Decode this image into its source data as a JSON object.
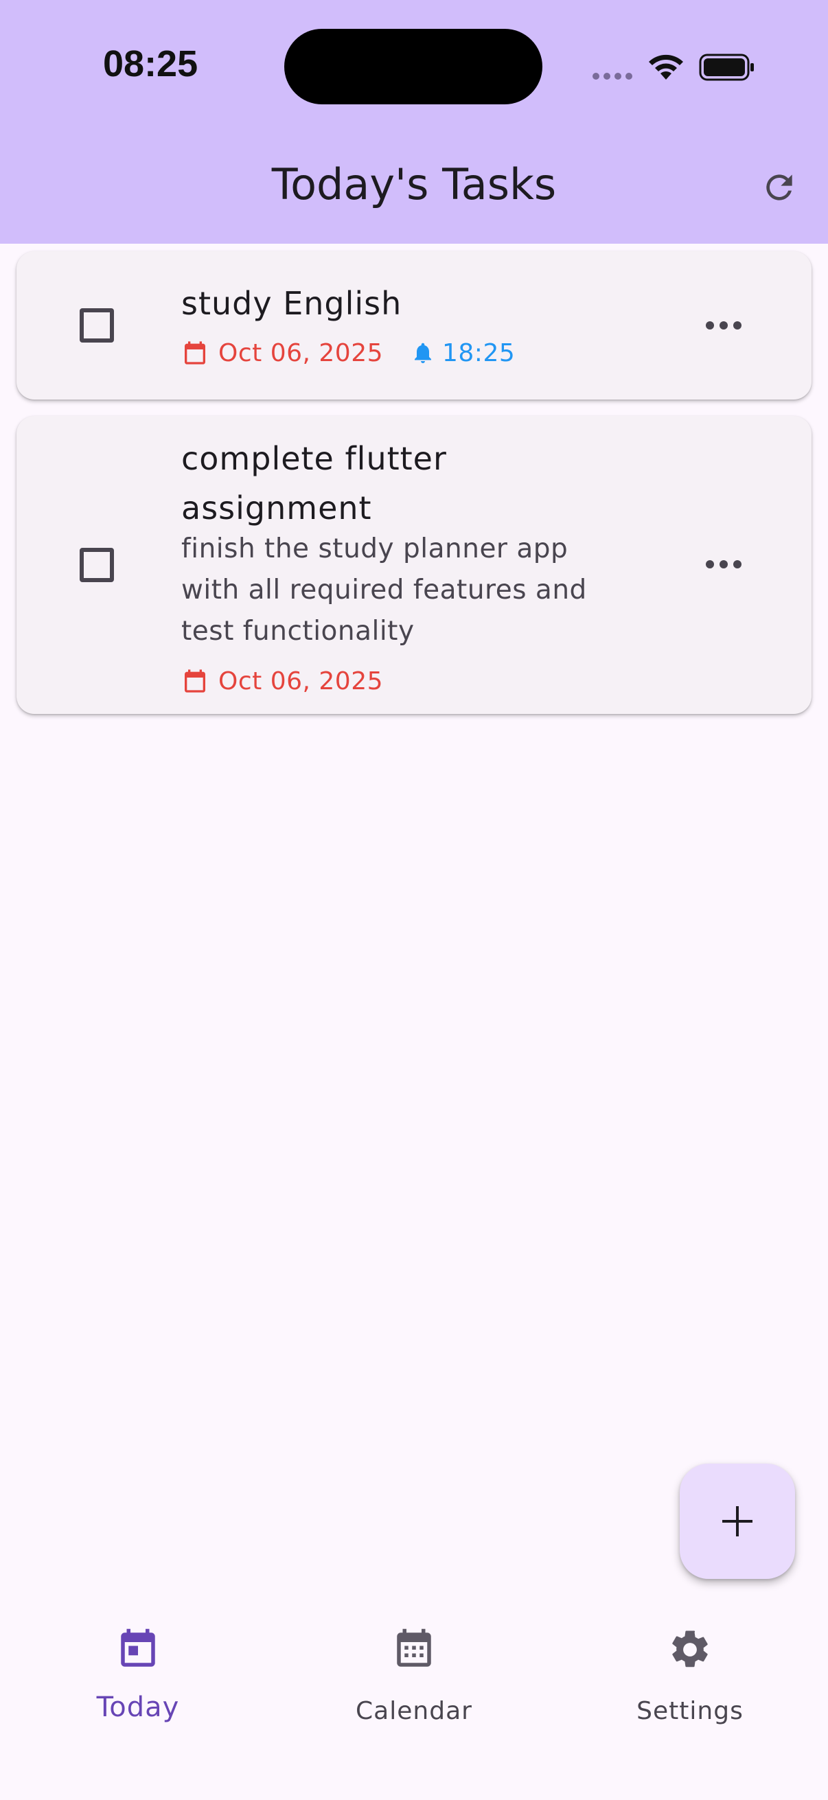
{
  "status_bar": {
    "time": "08:25"
  },
  "app_bar": {
    "title": "Today's Tasks",
    "refresh_icon": "refresh-icon"
  },
  "tasks": [
    {
      "title": "study English",
      "description": "",
      "date": "Oct 06, 2025",
      "reminder_time": "18:25",
      "completed": false
    },
    {
      "title": "complete flutter assignment",
      "description": "finish the study planner app with all required features and test functionality",
      "date": "Oct 06, 2025",
      "completed": false
    }
  ],
  "fab": {
    "icon": "plus-icon"
  },
  "bottom_nav": {
    "items": [
      {
        "label": "Today",
        "icon": "calendar-today-icon",
        "selected": true
      },
      {
        "label": "Calendar",
        "icon": "calendar-grid-icon",
        "selected": false
      },
      {
        "label": "Settings",
        "icon": "gear-icon",
        "selected": false
      }
    ]
  },
  "colors": {
    "app_bar": "#d1bdfb",
    "background": "#fdf7fe",
    "date_red": "#e5443d",
    "reminder_blue": "#2196f3",
    "nav_selected": "#6745b5",
    "fab": "#eadcfd"
  }
}
